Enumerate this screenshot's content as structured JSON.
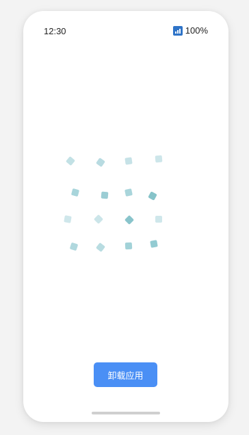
{
  "status_bar": {
    "time": "12:30",
    "battery": "100%",
    "signal_icon": "signal-icon"
  },
  "loading_animation": {
    "icon": "tile-grid-icon",
    "tile_count": 16,
    "colors": [
      "#c4e1e6",
      "#a3d3d8",
      "#8ec9cf"
    ]
  },
  "actions": {
    "uninstall_label": "卸载应用"
  },
  "accent_color": "#4a8ff5"
}
